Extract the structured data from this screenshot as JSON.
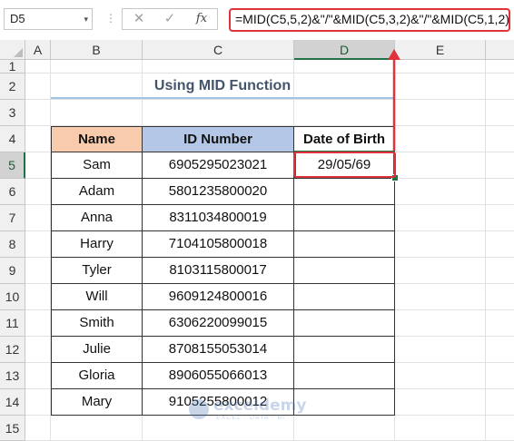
{
  "formula_bar": {
    "name_box": "D5",
    "name_box_arrow": "▾",
    "dots": "⋮",
    "cancel_glyph": "✕",
    "enter_glyph": "✓",
    "fx_label": "fx",
    "formula": "=MID(C5,5,2)&\"/\"&MID(C5,3,2)&\"/\"&MID(C5,1,2)"
  },
  "columns": [
    "A",
    "B",
    "C",
    "D",
    "E"
  ],
  "rows": [
    "1",
    "2",
    "3",
    "4",
    "5",
    "6",
    "7",
    "8",
    "9",
    "10",
    "11",
    "12",
    "13",
    "14",
    "15"
  ],
  "active_cell": {
    "column": "D",
    "row": "5"
  },
  "sheet": {
    "title": "Using MID Function",
    "headers": {
      "name": "Name",
      "id": "ID Number",
      "dob": "Date of Birth"
    },
    "records": [
      {
        "name": "Sam",
        "id": "6905295023021",
        "dob": "29/05/69"
      },
      {
        "name": "Adam",
        "id": "5801235800020",
        "dob": ""
      },
      {
        "name": "Anna",
        "id": "8311034800019",
        "dob": ""
      },
      {
        "name": "Harry",
        "id": "7104105800018",
        "dob": ""
      },
      {
        "name": "Tyler",
        "id": "8103115800017",
        "dob": ""
      },
      {
        "name": "Will",
        "id": "9609124800016",
        "dob": ""
      },
      {
        "name": "Smith",
        "id": "6306220099015",
        "dob": ""
      },
      {
        "name": "Julie",
        "id": "8708155053014",
        "dob": ""
      },
      {
        "name": "Gloria",
        "id": "8906055066013",
        "dob": ""
      },
      {
        "name": "Mary",
        "id": "9105255800012",
        "dob": ""
      }
    ]
  },
  "watermark": {
    "name": "exceldemy",
    "tagline": "EXCEL · DATA · BI"
  },
  "colors": {
    "annotation_red": "#e0323a",
    "name_header_fill": "#f8cbad",
    "id_header_fill": "#b4c7e7",
    "title_text": "#44546a",
    "title_underline": "#9dc3e6",
    "selection_green": "#217346"
  }
}
